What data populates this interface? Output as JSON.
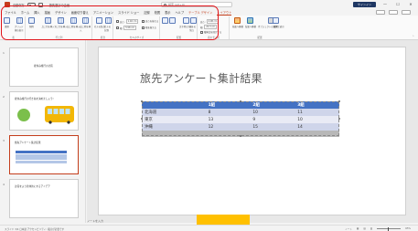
{
  "titlebar": {
    "autosave": "自動保存",
    "toggle_state": "オフ",
    "doc_title": "旅先選びの企画",
    "search_placeholder": "検索 (Alt+Q)",
    "signin": "サインイン",
    "minimize": "—",
    "maximize": "☐",
    "close": "✕"
  },
  "menu": {
    "items": [
      "ファイル",
      "ホーム",
      "挿入",
      "描画",
      "デザイン",
      "画面切り替え",
      "アニメーション",
      "スライド ショー",
      "記録",
      "校閲",
      "表示",
      "ヘルプ"
    ],
    "context_tab": "テーブル デザイン",
    "active_tab": "レイアウト"
  },
  "ribbon": {
    "groups": {
      "table_label": "表",
      "rows_cols_label": "行と列",
      "merge_label": "結合",
      "cell_size_label": "セルのサイズ",
      "align_label": "配置",
      "table_size_label": "表のサイズ",
      "arrange_label": "配置"
    },
    "buttons": {
      "select": "選択",
      "gridlines": "グリッド線の表示",
      "delete": "削除",
      "insert_above": "上に行を挿入",
      "insert_below": "下に行を挿入",
      "insert_left": "左に列を挿入",
      "insert_right": "右に列を挿入",
      "merge": "セルの結合",
      "split": "セルの分割",
      "text_direction": "文字列の方向",
      "cell_margins": "セルの余白",
      "front": "前面へ移動",
      "back": "背面へ移動",
      "selection_pane": "オブジェクトの選択と表示",
      "align": "配置"
    },
    "height_label": "高さ:",
    "height_value": "1.02 cm",
    "width_label": "幅:",
    "width_value": "5.58 cm",
    "distribute_rows": "高さを揃える",
    "distribute_cols": "幅を揃える",
    "table_height_label": "高さ:",
    "table_height_value": "4.08 cm",
    "table_width_label": "幅:",
    "table_width_value": "22.3 cm",
    "lock_aspect": "縦横比を固定する"
  },
  "thumbnails": [
    {
      "num": "1",
      "title": "夏休み旅行の計画"
    },
    {
      "num": "2",
      "title": "夏休み旅行の行き先を決めましょう!"
    },
    {
      "num": "3",
      "title": "旅先アンケート集計結果"
    },
    {
      "num": "4",
      "title": "計画をより具体的にするアイデア"
    }
  ],
  "slide": {
    "title": "旅先アンケート集計結果",
    "table": {
      "headers": [
        "",
        "1組",
        "2組",
        "3組"
      ],
      "rows": [
        [
          "北海道",
          "8",
          "10",
          "11"
        ],
        [
          "東京",
          "13",
          "9",
          "10"
        ],
        [
          "沖縄",
          "12",
          "15",
          "14"
        ]
      ]
    }
  },
  "notes": "ノートを入力",
  "status": {
    "left": "スライド 3/4  日本語  アクセシビリティ: 検討が必要です",
    "notes_btn": "ノート",
    "zoom": "65%"
  },
  "colors": {
    "accent": "#c43e1c",
    "table_header": "#4472c4",
    "highlight": "#e0141a",
    "bus": "#f2b707",
    "shape": "#ffc000"
  }
}
